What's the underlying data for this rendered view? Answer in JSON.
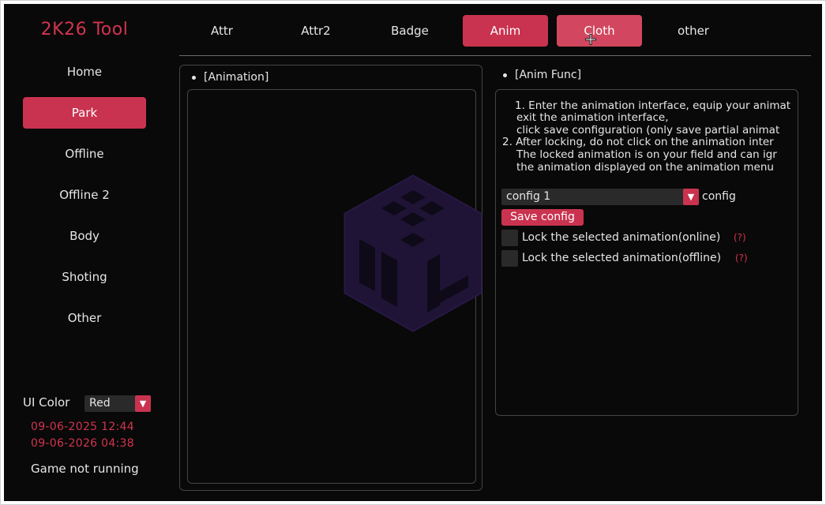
{
  "app_title": "2K26 Tool",
  "sidebar": {
    "items": [
      {
        "label": "Home"
      },
      {
        "label": "Park"
      },
      {
        "label": "Offline"
      },
      {
        "label": "Offline 2"
      },
      {
        "label": "Body"
      },
      {
        "label": "Shoting"
      },
      {
        "label": "Other"
      }
    ],
    "active": "Park",
    "ui_color_label": "UI Color",
    "ui_color_value": "Red",
    "date_start": "09-06-2025 12:44",
    "date_end": "09-06-2026 04:38",
    "game_status": "Game not running"
  },
  "tabs": [
    {
      "label": "Attr"
    },
    {
      "label": "Attr2"
    },
    {
      "label": "Badge"
    },
    {
      "label": "Anim"
    },
    {
      "label": "Cloth"
    },
    {
      "label": "other"
    }
  ],
  "active_tab": "Anim",
  "hovered_tab": "Cloth",
  "animation_panel": {
    "header": "[Animation]"
  },
  "anim_func": {
    "header": "[Anim Func]",
    "instructions": [
      "1. Enter the animation interface, equip your animat",
      "exit the animation interface,",
      "click save configuration (only save partial animat",
      "2. After locking, do not click on the animation inter",
      "The locked animation is on your field and can igr",
      "the animation displayed on the animation menu"
    ],
    "config_select_value": "config 1",
    "config_label": "config",
    "save_button": "Save config",
    "lock_online_label": "Lock the selected animation(online)",
    "lock_offline_label": "Lock the selected animation(offline)",
    "help_text": "(?)"
  },
  "colors": {
    "accent": "#c9334f",
    "background": "#090909",
    "logo": "#2a1a4a"
  }
}
